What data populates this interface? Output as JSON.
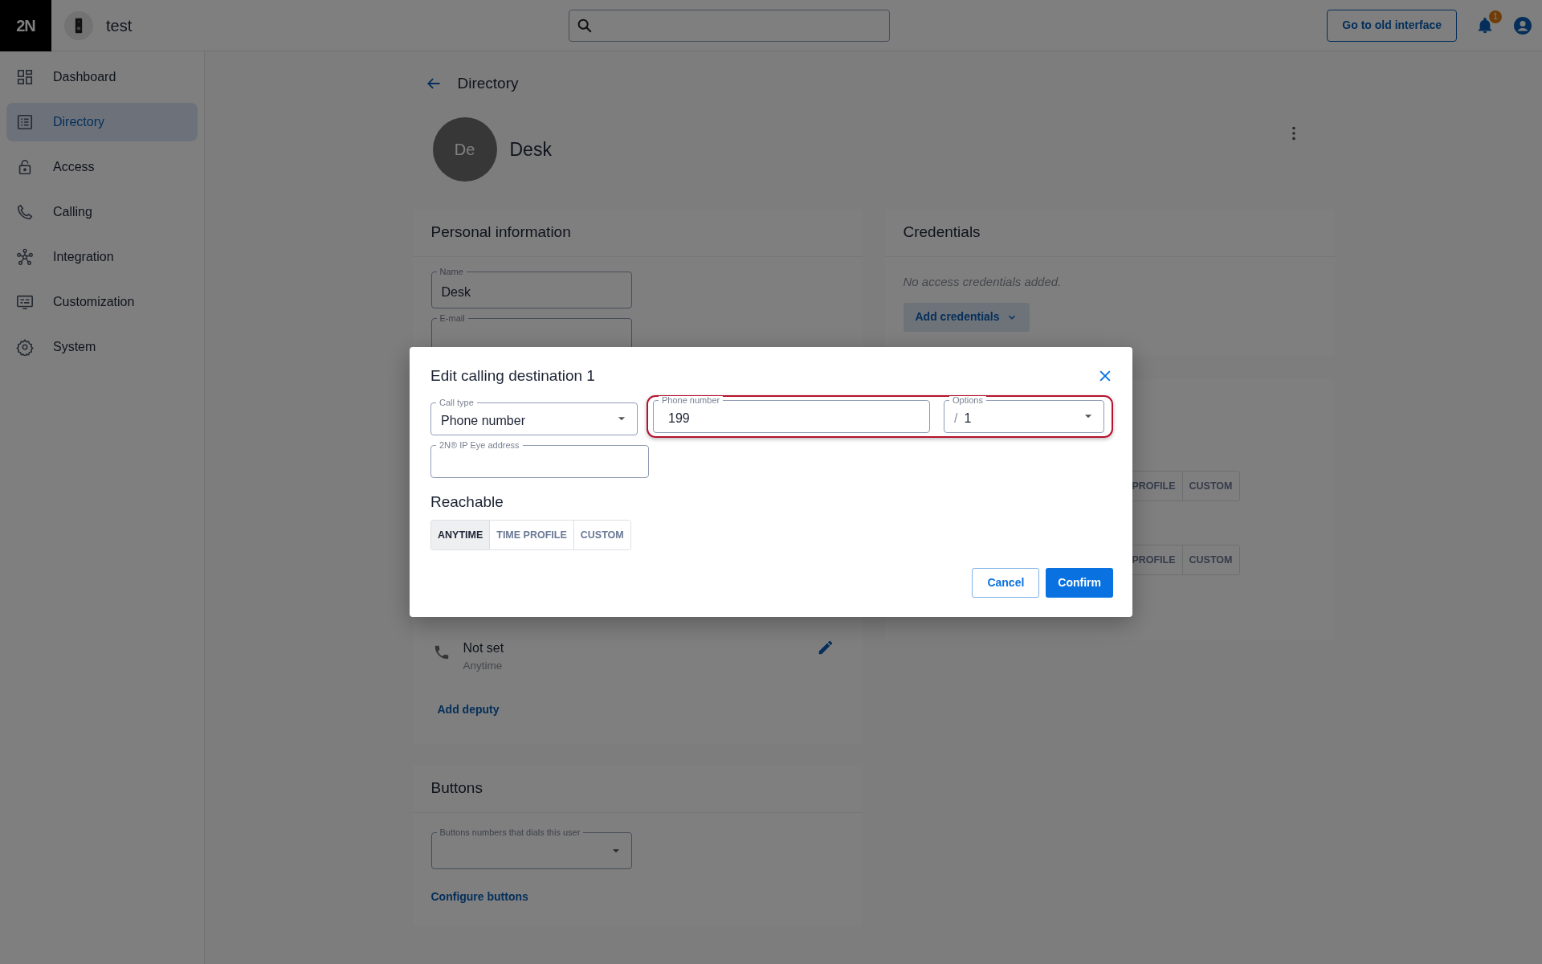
{
  "topbar": {
    "logo": "2N",
    "device_name": "test",
    "old_interface_button": "Go to old interface",
    "notification_count": "1"
  },
  "sidebar": {
    "items": [
      {
        "label": "Dashboard",
        "selected": false
      },
      {
        "label": "Directory",
        "selected": true
      },
      {
        "label": "Access",
        "selected": false
      },
      {
        "label": "Calling",
        "selected": false
      },
      {
        "label": "Integration",
        "selected": false
      },
      {
        "label": "Customization",
        "selected": false
      },
      {
        "label": "System",
        "selected": false
      }
    ]
  },
  "page": {
    "title": "Directory",
    "user": {
      "initials": "De",
      "name": "Desk"
    }
  },
  "personal_information": {
    "title": "Personal information",
    "fields": [
      {
        "label": "Name",
        "value": "Desk"
      },
      {
        "label": "E-mail"
      }
    ],
    "deputy": {
      "title": "Not set",
      "subtitle": "Anytime"
    },
    "add_deputy": "Add deputy"
  },
  "credentials": {
    "title": "Credentials",
    "empty_text": "No access credentials added.",
    "add_button": "Add credentials"
  },
  "reachability_card": {
    "rows": [
      {
        "segments": [
          "PROFILE",
          "CUSTOM"
        ]
      },
      {
        "segments": [
          "PROFILE",
          "CUSTOM"
        ]
      }
    ]
  },
  "buttons_card": {
    "title": "Buttons",
    "field": {
      "label": "Buttons numbers that dials this user"
    },
    "link": "Configure buttons"
  },
  "dialog": {
    "title": "Edit calling destination 1",
    "fields": [
      {
        "kind": "select",
        "label": "Call type",
        "value": "Phone number",
        "highlighted": false
      },
      {
        "kind": "text",
        "label": "Phone number",
        "value": "199",
        "highlighted": true
      },
      {
        "kind": "select",
        "label": "Options",
        "prefix": "/",
        "value": "1",
        "highlighted": true
      },
      {
        "kind": "text",
        "label": "2N® IP Eye address",
        "highlighted": false
      }
    ],
    "reachable": {
      "title": "Reachable",
      "options": [
        {
          "label": "ANYTIME",
          "selected": true
        },
        {
          "label": "TIME PROFILE",
          "selected": false
        },
        {
          "label": "CUSTOM",
          "selected": false
        }
      ]
    },
    "buttons": [
      {
        "label": "Cancel",
        "kind": "secondary"
      },
      {
        "label": "Confirm",
        "kind": "primary"
      }
    ]
  }
}
